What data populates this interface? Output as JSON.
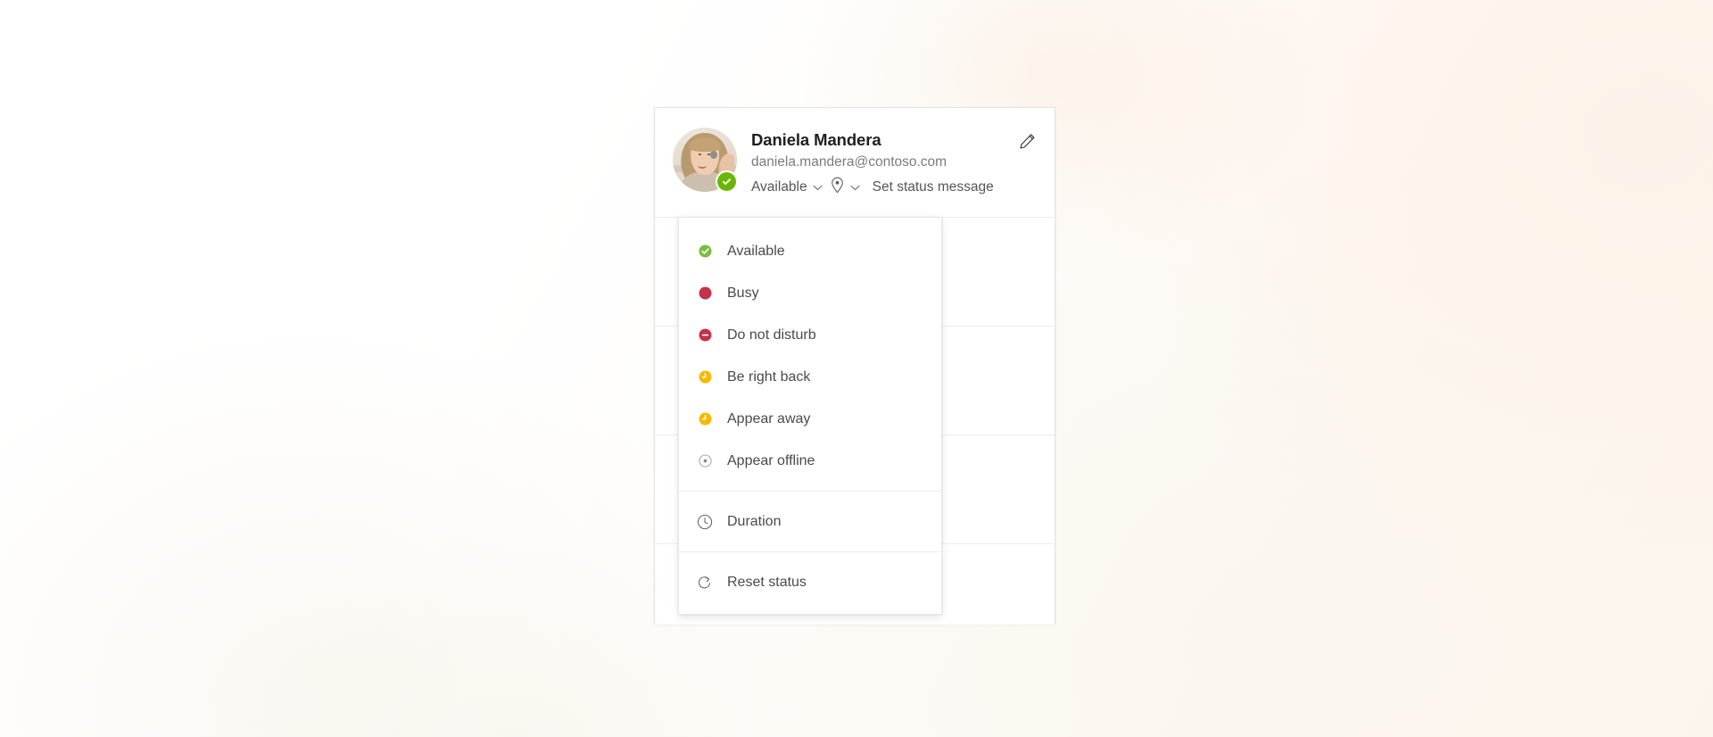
{
  "background": {
    "base_color": "#ffffff",
    "warm_tint": "#fdf4ea"
  },
  "profile_card": {
    "accent_available": "#6bb700",
    "user": {
      "name": "Daniela Mandera",
      "email": "daniela.mandera@contoso.com"
    },
    "avatar": {
      "icon": "user-photo-avatar",
      "presence_icon": "available-check-icon"
    },
    "status_row": {
      "current_status": "Available",
      "status_chevron": "chevron-down-icon",
      "location_icon": "location-pin-icon",
      "location_chevron": "chevron-down-icon",
      "set_status_message": "Set status message"
    },
    "edit_icon": "pencil-edit-icon"
  },
  "presence_menu": {
    "statuses": [
      {
        "label": "Available",
        "icon": "available-icon",
        "color": "#6bb700"
      },
      {
        "label": "Busy",
        "icon": "busy-icon",
        "color": "#c4314b"
      },
      {
        "label": "Do not disturb",
        "icon": "do-not-disturb-icon",
        "color": "#c4314b"
      },
      {
        "label": "Be right back",
        "icon": "be-right-back-icon",
        "color": "#f8b800"
      },
      {
        "label": "Appear away",
        "icon": "appear-away-icon",
        "color": "#f8b800"
      },
      {
        "label": "Appear offline",
        "icon": "appear-offline-icon",
        "color": "#a8a8a8"
      }
    ],
    "actions": [
      {
        "label": "Duration",
        "icon": "clock-icon"
      },
      {
        "label": "Reset status",
        "icon": "reset-refresh-icon"
      }
    ]
  }
}
